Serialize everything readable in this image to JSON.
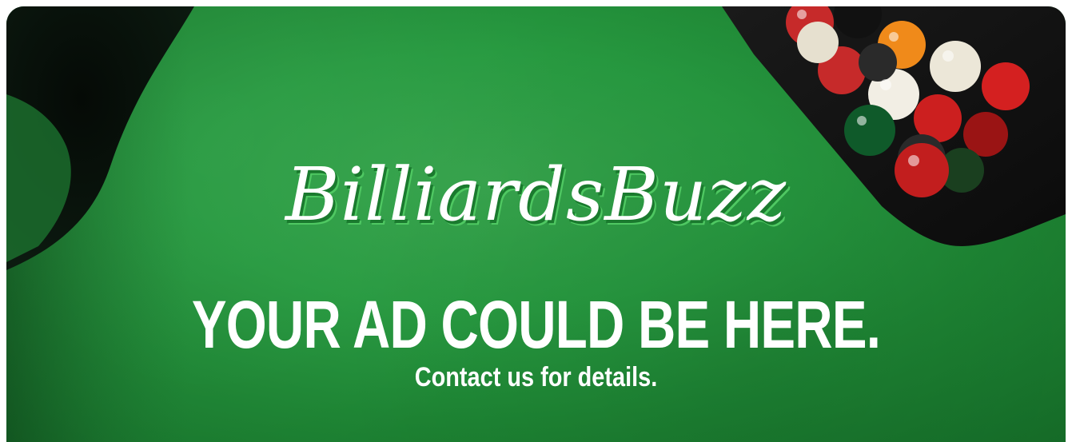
{
  "brand": {
    "name": "BilliardsBuzz"
  },
  "ad": {
    "headline": "YOUR AD COULD BE HERE.",
    "subline": "Contact us for details."
  },
  "colors": {
    "felt": "#279a40",
    "text": "#ffffff",
    "logo_shadow": "#4fc862"
  },
  "icons": {
    "rack": "billiard-ball-rack-icon",
    "pocket": "table-pocket-icon"
  }
}
